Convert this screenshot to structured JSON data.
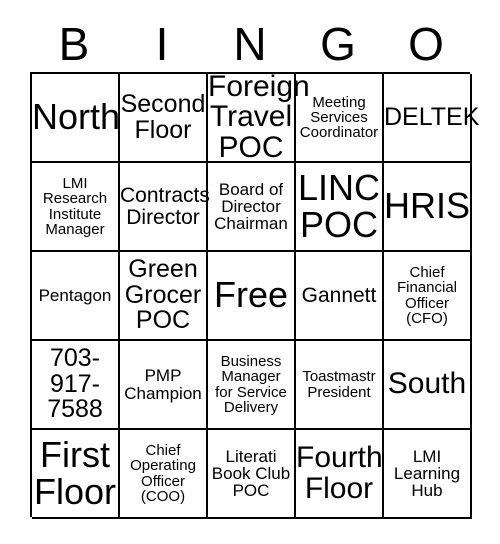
{
  "card": {
    "header_letters": [
      "B",
      "I",
      "N",
      "G",
      "O"
    ],
    "columns": 5,
    "rows": 5,
    "border_color": "#000000",
    "background_color": "#ffffff",
    "text_color": "#000000",
    "free_space_label": "Free",
    "cells": [
      {
        "id": "b1",
        "column": "B",
        "row": 1,
        "text": "North"
      },
      {
        "id": "i1",
        "column": "I",
        "row": 1,
        "text": "Second\nFloor"
      },
      {
        "id": "n1",
        "column": "N",
        "row": 1,
        "text": "Foreign\nTravel\nPOC"
      },
      {
        "id": "g1",
        "column": "G",
        "row": 1,
        "text": "Meeting\nServices\nCoordinator"
      },
      {
        "id": "o1",
        "column": "O",
        "row": 1,
        "text": "DELTEK"
      },
      {
        "id": "b2",
        "column": "B",
        "row": 2,
        "text": "LMI\nResearch\nInstitute\nManager"
      },
      {
        "id": "i2",
        "column": "I",
        "row": 2,
        "text": "Contracts\nDirector"
      },
      {
        "id": "n2",
        "column": "N",
        "row": 2,
        "text": "Board of\nDirector\nChairman"
      },
      {
        "id": "g2",
        "column": "G",
        "row": 2,
        "text": "LINC\nPOC"
      },
      {
        "id": "o2",
        "column": "O",
        "row": 2,
        "text": "HRIS"
      },
      {
        "id": "b3",
        "column": "B",
        "row": 3,
        "text": "Pentagon"
      },
      {
        "id": "i3",
        "column": "I",
        "row": 3,
        "text": "Green\nGrocer\nPOC"
      },
      {
        "id": "n3",
        "column": "N",
        "row": 3,
        "text": "Free"
      },
      {
        "id": "g3",
        "column": "G",
        "row": 3,
        "text": "Gannett"
      },
      {
        "id": "o3",
        "column": "O",
        "row": 3,
        "text": "Chief\nFinancial\nOfficer\n(CFO)"
      },
      {
        "id": "b4",
        "column": "B",
        "row": 4,
        "text": "703-\n917-\n7588"
      },
      {
        "id": "i4",
        "column": "I",
        "row": 4,
        "text": "PMP\nChampion"
      },
      {
        "id": "n4",
        "column": "N",
        "row": 4,
        "text": "Business\nManager\nfor Service\nDelivery"
      },
      {
        "id": "g4",
        "column": "G",
        "row": 4,
        "text": "Toastmastr\nPresident"
      },
      {
        "id": "o4",
        "column": "O",
        "row": 4,
        "text": "South"
      },
      {
        "id": "b5",
        "column": "B",
        "row": 5,
        "text": "First\nFloor"
      },
      {
        "id": "i5",
        "column": "I",
        "row": 5,
        "text": "Chief\nOperating\nOfficer\n(COO)"
      },
      {
        "id": "n5",
        "column": "N",
        "row": 5,
        "text": "Literati\nBook Club\nPOC"
      },
      {
        "id": "g5",
        "column": "G",
        "row": 5,
        "text": "Fourth\nFloor"
      },
      {
        "id": "o5",
        "column": "O",
        "row": 5,
        "text": "LMI\nLearning\nHub"
      }
    ]
  }
}
